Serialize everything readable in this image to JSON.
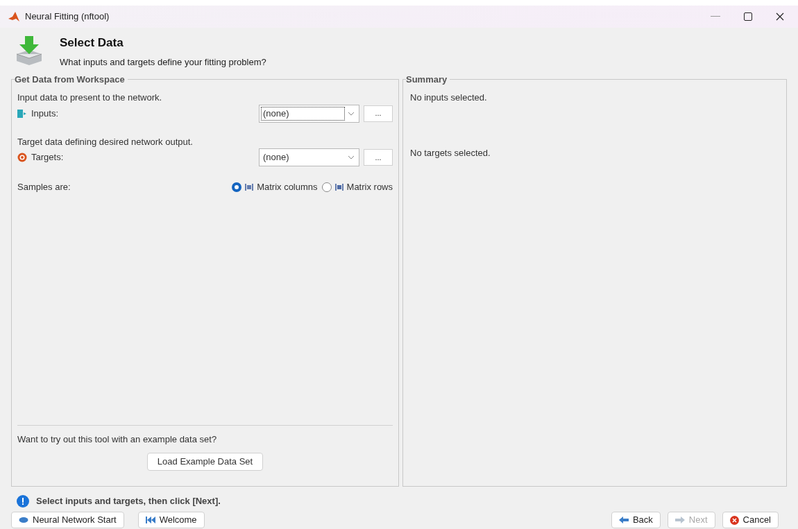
{
  "window": {
    "title": "Neural Fitting (nftool)"
  },
  "header": {
    "title": "Select Data",
    "subtitle": "What inputs and targets define your fitting problem?"
  },
  "workspace_panel": {
    "title": "Get Data from Workspace",
    "fields": [
      {
        "kind": "inputs",
        "description": "Input data to present to the network.",
        "label": "Inputs:",
        "value": "(none)",
        "focused": true,
        "browse": "..."
      },
      {
        "kind": "targets",
        "description": "Target data defining desired network output.",
        "label": "Targets:",
        "value": "(none)",
        "focused": false,
        "browse": "..."
      }
    ],
    "samples": {
      "label": "Samples are:",
      "options": [
        {
          "kind": "columns",
          "label": "Matrix columns",
          "selected": true
        },
        {
          "kind": "rows",
          "label": "Matrix rows",
          "selected": false
        }
      ]
    },
    "example_prompt": "Want to try out this tool with an example data set?",
    "example_button": "Load Example Data Set"
  },
  "summary_panel": {
    "title": "Summary",
    "lines": [
      "No inputs selected.",
      "No targets selected."
    ]
  },
  "status_message": "Select inputs and targets, then click [Next].",
  "left_buttons": [
    {
      "kind": "start",
      "label": "Neural Network Start",
      "disabled": false
    },
    {
      "kind": "welcome",
      "label": "Welcome",
      "disabled": false
    }
  ],
  "right_buttons": [
    {
      "kind": "back",
      "label": "Back",
      "disabled": false
    },
    {
      "kind": "next",
      "label": "Next",
      "disabled": true
    },
    {
      "kind": "cancel",
      "label": "Cancel",
      "disabled": false
    }
  ]
}
